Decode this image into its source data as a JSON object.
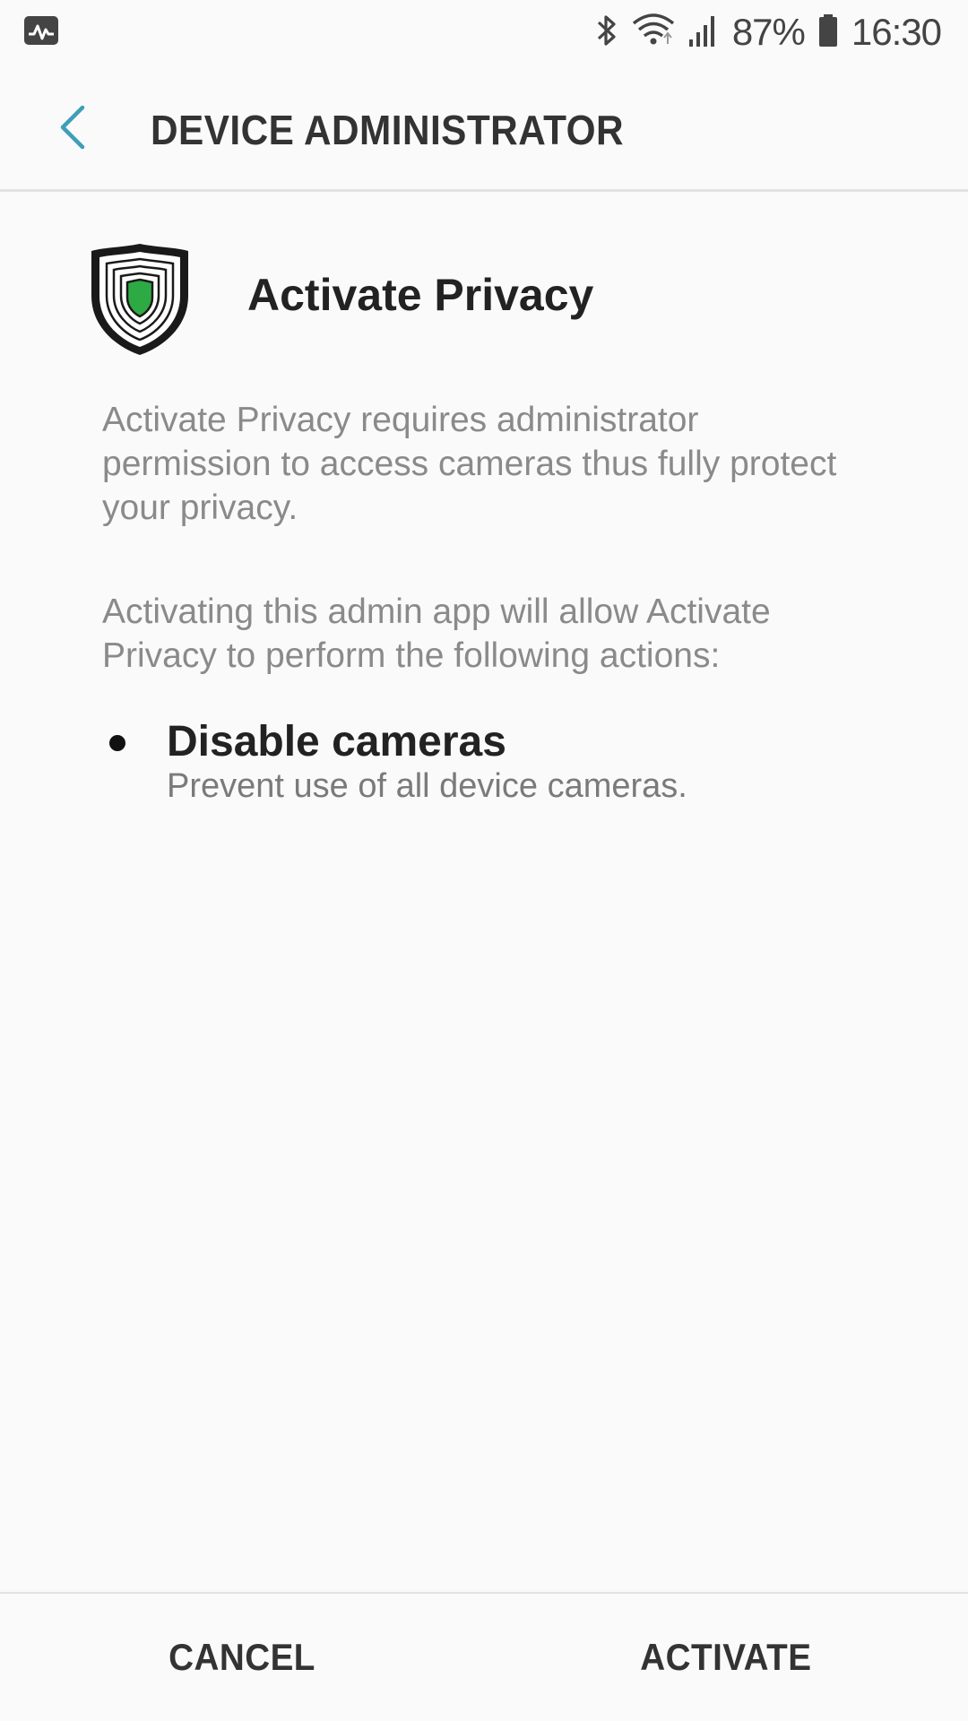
{
  "status_bar": {
    "left_icon": "activity-monitor-icon",
    "icons": [
      "bluetooth-icon",
      "wifi-icon",
      "signal-icon",
      "battery-icon"
    ],
    "battery_percent": "87%",
    "time": "16:30"
  },
  "app_bar": {
    "back_icon": "chevron-left-icon",
    "title": "DEVICE ADMINISTRATOR",
    "accent_color": "#3d9fb8"
  },
  "app": {
    "icon": "shield-fingerprint-icon",
    "name": "Activate Privacy",
    "icon_accent": "#2eaa44"
  },
  "content": {
    "description": "Activate Privacy requires administrator permission to access cameras thus fully protect your privacy.",
    "permission_intro": "Activating this admin app will allow Activate Privacy to perform the following actions:",
    "actions": [
      {
        "title": "Disable cameras",
        "description": "Prevent use of all device cameras."
      }
    ]
  },
  "buttons": {
    "cancel": "CANCEL",
    "activate": "ACTIVATE"
  }
}
